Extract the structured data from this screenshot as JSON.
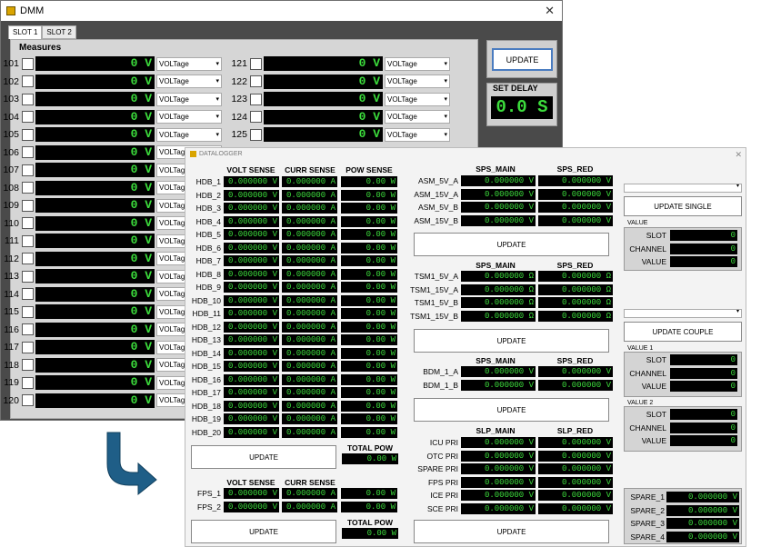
{
  "dmm": {
    "title": "DMM",
    "close": "✕",
    "tabs": [
      "SLOT 1",
      "SLOT 2"
    ],
    "measures_label": "Measures",
    "rows_left": [
      {
        "num": "101",
        "val": "0 V",
        "mode": "VOLTage"
      },
      {
        "num": "102",
        "val": "0 V",
        "mode": "VOLTage"
      },
      {
        "num": "103",
        "val": "0 V",
        "mode": "VOLTage"
      },
      {
        "num": "104",
        "val": "0 V",
        "mode": "VOLTage"
      },
      {
        "num": "105",
        "val": "0 V",
        "mode": "VOLTage"
      },
      {
        "num": "106",
        "val": "0 V",
        "mode": "VOLTage"
      },
      {
        "num": "107",
        "val": "0 V",
        "mode": "VOLTage"
      },
      {
        "num": "108",
        "val": "0 V",
        "mode": "VOLTage"
      },
      {
        "num": "109",
        "val": "0 V",
        "mode": "VOLTage"
      },
      {
        "num": "110",
        "val": "0 V",
        "mode": "VOLTage"
      },
      {
        "num": "111",
        "val": "0 V",
        "mode": "VOLTage"
      },
      {
        "num": "112",
        "val": "0 V",
        "mode": "VOLTage"
      },
      {
        "num": "113",
        "val": "0 V",
        "mode": "VOLTage"
      },
      {
        "num": "114",
        "val": "0 V",
        "mode": "VOLTage"
      },
      {
        "num": "115",
        "val": "0 V",
        "mode": "VOLTage"
      },
      {
        "num": "116",
        "val": "0 V",
        "mode": "VOLTage"
      },
      {
        "num": "117",
        "val": "0 V",
        "mode": "VOLTage"
      },
      {
        "num": "118",
        "val": "0 V",
        "mode": "VOLTage"
      },
      {
        "num": "119",
        "val": "0 V",
        "mode": "VOLTage"
      },
      {
        "num": "120",
        "val": "0 V",
        "mode": "VOLTage"
      }
    ],
    "rows_right": [
      {
        "num": "121",
        "val": "0 V",
        "mode": "VOLTage"
      },
      {
        "num": "122",
        "val": "0 V",
        "mode": "VOLTage"
      },
      {
        "num": "123",
        "val": "0 V",
        "mode": "VOLTage"
      },
      {
        "num": "124",
        "val": "0 V",
        "mode": "VOLTage"
      },
      {
        "num": "125",
        "val": "0 V",
        "mode": "VOLTage"
      }
    ],
    "update_label": "UPDATE",
    "set_delay_label": "SET DELAY",
    "delay_value": "0.0 S"
  },
  "datalogger": {
    "title": "DATALOGGER",
    "close": "✕",
    "hdb_headers": {
      "volt": "VOLT SENSE",
      "curr": "CURR SENSE",
      "pow": "POW SENSE"
    },
    "hdb_rows": [
      {
        "label": "HDB_1",
        "volt": "0.000000 V",
        "curr": "0.000000 A",
        "pow": "0.00 W"
      },
      {
        "label": "HDB_2",
        "volt": "0.000000 V",
        "curr": "0.000000 A",
        "pow": "0.00 W"
      },
      {
        "label": "HDB_3",
        "volt": "0.000000 V",
        "curr": "0.000000 A",
        "pow": "0.00 W"
      },
      {
        "label": "HDB_4",
        "volt": "0.000000 V",
        "curr": "0.000000 A",
        "pow": "0.00 W"
      },
      {
        "label": "HDB_5",
        "volt": "0.000000 V",
        "curr": "0.000000 A",
        "pow": "0.00 W"
      },
      {
        "label": "HDB_6",
        "volt": "0.000000 V",
        "curr": "0.000000 A",
        "pow": "0.00 W"
      },
      {
        "label": "HDB_7",
        "volt": "0.000000 V",
        "curr": "0.000000 A",
        "pow": "0.00 W"
      },
      {
        "label": "HDB_8",
        "volt": "0.000000 V",
        "curr": "0.000000 A",
        "pow": "0.00 W"
      },
      {
        "label": "HDB_9",
        "volt": "0.000000 V",
        "curr": "0.000000 A",
        "pow": "0.00 W"
      },
      {
        "label": "HDB_10",
        "volt": "0.000000 V",
        "curr": "0.000000 A",
        "pow": "0.00 W"
      },
      {
        "label": "HDB_11",
        "volt": "0.000000 V",
        "curr": "0.000000 A",
        "pow": "0.00 W"
      },
      {
        "label": "HDB_12",
        "volt": "0.000000 V",
        "curr": "0.000000 A",
        "pow": "0.00 W"
      },
      {
        "label": "HDB_13",
        "volt": "0.000000 V",
        "curr": "0.000000 A",
        "pow": "0.00 W"
      },
      {
        "label": "HDB_14",
        "volt": "0.000000 V",
        "curr": "0.000000 A",
        "pow": "0.00 W"
      },
      {
        "label": "HDB_15",
        "volt": "0.000000 V",
        "curr": "0.000000 A",
        "pow": "0.00 W"
      },
      {
        "label": "HDB_16",
        "volt": "0.000000 V",
        "curr": "0.000000 A",
        "pow": "0.00 W"
      },
      {
        "label": "HDB_17",
        "volt": "0.000000 V",
        "curr": "0.000000 A",
        "pow": "0.00 W"
      },
      {
        "label": "HDB_18",
        "volt": "0.000000 V",
        "curr": "0.000000 A",
        "pow": "0.00 W"
      },
      {
        "label": "HDB_19",
        "volt": "0.000000 V",
        "curr": "0.000000 A",
        "pow": "0.00 W"
      },
      {
        "label": "HDB_20",
        "volt": "0.000000 V",
        "curr": "0.000000 A",
        "pow": "0.00 W"
      }
    ],
    "hdb_update": "UPDATE",
    "total_pow_label": "TOTAL POW",
    "hdb_total": "0.00 W",
    "fps_headers": {
      "volt": "VOLT SENSE",
      "curr": "CURR SENSE"
    },
    "fps_rows": [
      {
        "label": "FPS_1",
        "volt": "0.000000 V",
        "curr": "0.000000 A",
        "pow": "0.00 W"
      },
      {
        "label": "FPS_2",
        "volt": "0.000000 V",
        "curr": "0.000000 A",
        "pow": "0.00 W"
      }
    ],
    "fps_update": "UPDATE",
    "fps_total_label": "TOTAL POW",
    "fps_total": "0.00 W",
    "asm_headers": {
      "a": "SPS_MAIN",
      "b": "SPS_RED"
    },
    "asm_rows": [
      {
        "label": "ASM_5V_A",
        "a": "0.000000 V",
        "b": "0.000000 V"
      },
      {
        "label": "ASM_15V_A",
        "a": "0.000000 V",
        "b": "0.000000 V"
      },
      {
        "label": "ASM_5V_B",
        "a": "0.000000 V",
        "b": "0.000000 V"
      },
      {
        "label": "ASM_15V_B",
        "a": "0.000000 V",
        "b": "0.000000 V"
      }
    ],
    "asm_update": "UPDATE",
    "tsm_headers": {
      "a": "SPS_MAIN",
      "b": "SPS_RED"
    },
    "tsm_rows": [
      {
        "label": "TSM1_5V_A",
        "a": "0.000000 Ω",
        "b": "0.000000 Ω"
      },
      {
        "label": "TSM1_15V_A",
        "a": "0.000000 Ω",
        "b": "0.000000 Ω"
      },
      {
        "label": "TSM1_5V_B",
        "a": "0.000000 Ω",
        "b": "0.000000 Ω"
      },
      {
        "label": "TSM1_15V_B",
        "a": "0.000000 Ω",
        "b": "0.000000 Ω"
      }
    ],
    "tsm_update": "UPDATE",
    "bdm_headers": {
      "a": "SPS_MAIN",
      "b": "SPS_RED"
    },
    "bdm_rows": [
      {
        "label": "BDM_1_A",
        "a": "0.000000 V",
        "b": "0.000000 V"
      },
      {
        "label": "BDM_1_B",
        "a": "0.000000 V",
        "b": "0.000000 V"
      }
    ],
    "bdm_update": "UPDATE",
    "slp_headers": {
      "a": "SLP_MAIN",
      "b": "SLP_RED"
    },
    "slp_rows": [
      {
        "label": "ICU PRI",
        "a": "0.000000 V",
        "b": "0.000000 V"
      },
      {
        "label": "OTC PRI",
        "a": "0.000000 V",
        "b": "0.000000 V"
      },
      {
        "label": "SPARE PRI",
        "a": "0.000000 V",
        "b": "0.000000 V"
      },
      {
        "label": "FPS PRI",
        "a": "0.000000 V",
        "b": "0.000000 V"
      },
      {
        "label": "ICE PRI",
        "a": "0.000000 V",
        "b": "0.000000 V"
      },
      {
        "label": "SCE PRI",
        "a": "0.000000 V",
        "b": "0.000000 V"
      }
    ],
    "slp_update": "UPDATE",
    "single": {
      "button": "UPDATE SINGLE",
      "value_label": "VALUE",
      "fields": [
        {
          "label": "SLOT",
          "val": "0"
        },
        {
          "label": "CHANNEL",
          "val": "0"
        },
        {
          "label": "VALUE",
          "val": "0"
        }
      ]
    },
    "couple": {
      "button": "UPDATE COUPLE",
      "value1_label": "VALUE 1",
      "value1": [
        {
          "label": "SLOT",
          "val": "0"
        },
        {
          "label": "CHANNEL",
          "val": "0"
        },
        {
          "label": "VALUE",
          "val": "0"
        }
      ],
      "value2_label": "VALUE 2",
      "value2": [
        {
          "label": "SLOT",
          "val": "0"
        },
        {
          "label": "CHANNEL",
          "val": "0"
        },
        {
          "label": "VALUE",
          "val": "0"
        }
      ]
    },
    "spares": [
      {
        "label": "SPARE_1",
        "val": "0.000000 V"
      },
      {
        "label": "SPARE_2",
        "val": "0.000000 V"
      },
      {
        "label": "SPARE_3",
        "val": "0.000000 V"
      },
      {
        "label": "SPARE_4",
        "val": "0.000000 V"
      }
    ]
  },
  "colors": {
    "display_text": "#3cdc3c",
    "display_bg": "#000000",
    "arrow": "#1f5e87"
  }
}
